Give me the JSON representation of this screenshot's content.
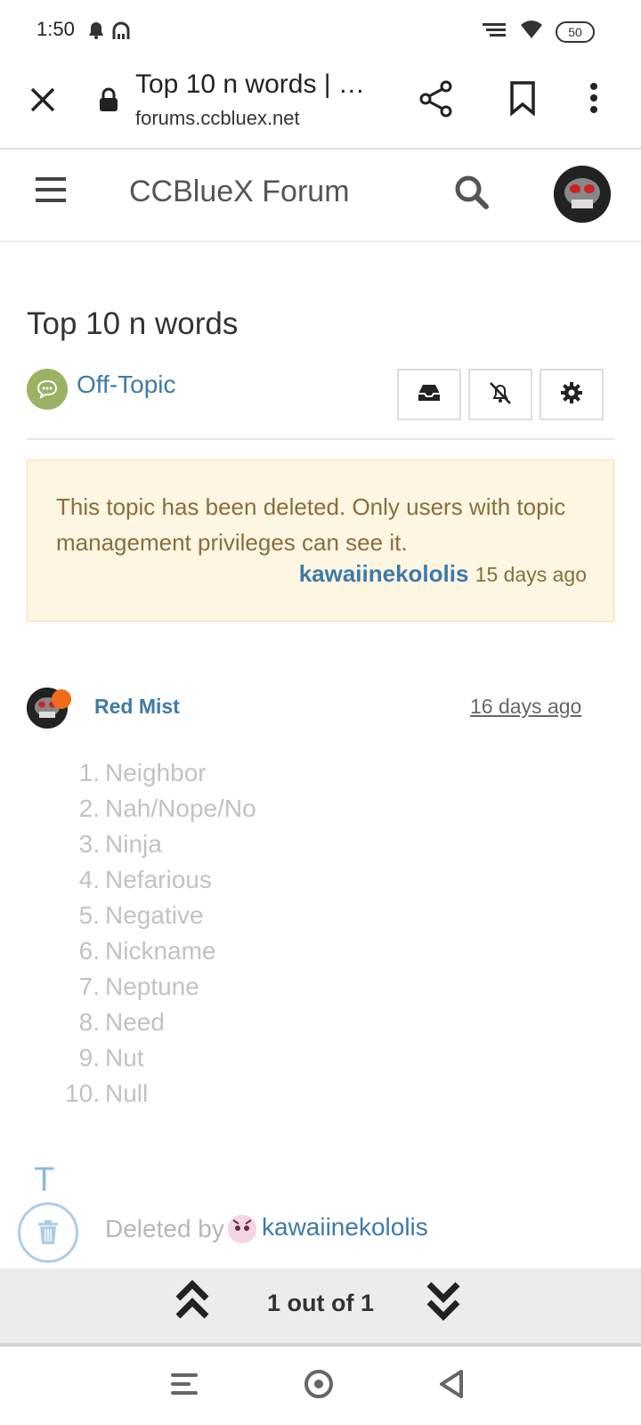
{
  "status_bar": {
    "time": "1:50",
    "battery": "50"
  },
  "browser": {
    "title": "Top 10 n words | …",
    "domain": "forums.ccbluex.net"
  },
  "forum": {
    "name": "CCBlueX Forum"
  },
  "topic": {
    "title": "Top 10 n words",
    "category": "Off-Topic",
    "category_color": "#99b263",
    "notice": {
      "text": "This topic has been deleted. Only users with topic management privileges can see it.",
      "user": "kawaiinekololis",
      "time": "15 days ago"
    }
  },
  "post": {
    "author": "Red Mist",
    "time": "16 days ago",
    "items": [
      {
        "num": "1.",
        "text": "Neighbor"
      },
      {
        "num": "2.",
        "text": "Nah/Nope/No"
      },
      {
        "num": "3.",
        "text": "Ninja"
      },
      {
        "num": "4.",
        "text": "Nefarious"
      },
      {
        "num": "5.",
        "text": "Negative"
      },
      {
        "num": "6.",
        "text": "Nickname"
      },
      {
        "num": "7.",
        "text": "Neptune"
      },
      {
        "num": "8.",
        "text": "Need"
      },
      {
        "num": "9.",
        "text": "Nut"
      },
      {
        "num": "10.",
        "text": "Null"
      }
    ]
  },
  "timeline": {
    "t_label": "T",
    "deleted_by_label": "Deleted by",
    "deleted_by_user": "kawaiinekololis"
  },
  "pager": {
    "text": "1 out of 1"
  },
  "colors": {
    "link": "#3e7aa8",
    "notice_bg": "#fcf6e3",
    "online": "#f26b1d"
  }
}
